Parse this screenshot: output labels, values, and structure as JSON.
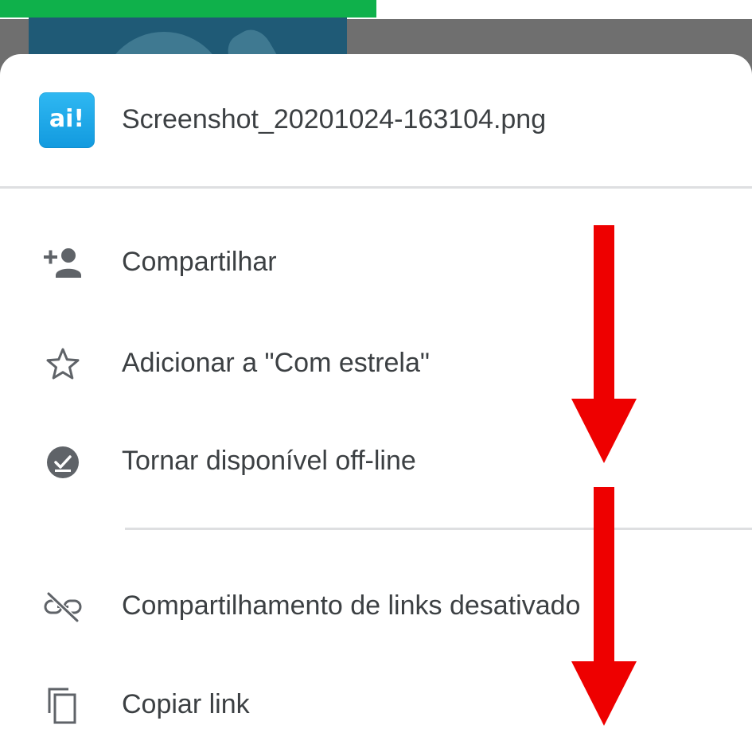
{
  "status_bar": {
    "upload_progress": 0.5
  },
  "sheet": {
    "file_name": "Screenshot_20201024-163104.png",
    "file_icon_text": "ai!",
    "menu": [
      {
        "label": "Compartilhar",
        "icon": "person-add-icon"
      },
      {
        "label": "Adicionar a \"Com estrela\"",
        "icon": "star-outline-icon"
      },
      {
        "label": "Tornar disponível off-line",
        "icon": "offline-check-icon"
      },
      {
        "label": "Compartilhamento de links desativado",
        "icon": "link-off-icon"
      },
      {
        "label": "Copiar link",
        "icon": "copy-icon"
      }
    ]
  },
  "annotations": {
    "arrow_color": "#ee0000",
    "arrow_count": 2
  },
  "colors": {
    "progress": "#0fb14b",
    "text": "#3c4043",
    "icon": "#5f6368",
    "divider": "#dedfe1"
  }
}
